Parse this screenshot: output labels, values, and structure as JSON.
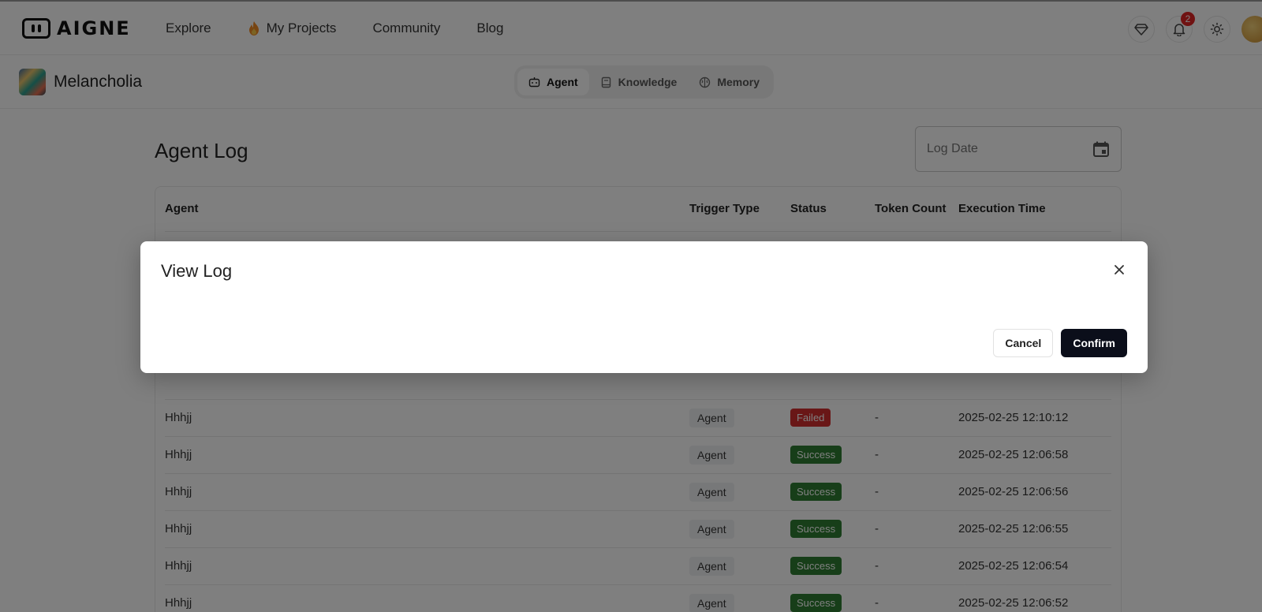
{
  "brand": {
    "name": "AIGNE"
  },
  "nav": {
    "items": [
      {
        "label": "Explore"
      },
      {
        "label": "My Projects"
      },
      {
        "label": "Community"
      },
      {
        "label": "Blog"
      }
    ]
  },
  "header_right": {
    "notification_count": "2"
  },
  "project": {
    "name": "Melancholia"
  },
  "tabs": [
    {
      "label": "Agent"
    },
    {
      "label": "Knowledge"
    },
    {
      "label": "Memory"
    }
  ],
  "page": {
    "title": "Agent Log",
    "date_placeholder": "Log Date"
  },
  "table": {
    "headers": {
      "agent": "Agent",
      "trigger_type": "Trigger Type",
      "status": "Status",
      "token_count": "Token Count",
      "execution_time": "Execution Time"
    },
    "rows": [
      {
        "agent": "Hhhjj",
        "trigger_type": "Agent",
        "status": "Failed",
        "token_count": "-",
        "execution_time": "2025-02-25 12:10:12"
      },
      {
        "agent": "Hhhjj",
        "trigger_type": "Agent",
        "status": "Success",
        "token_count": "-",
        "execution_time": "2025-02-25 12:06:58"
      },
      {
        "agent": "Hhhjj",
        "trigger_type": "Agent",
        "status": "Success",
        "token_count": "-",
        "execution_time": "2025-02-25 12:06:56"
      },
      {
        "agent": "Hhhjj",
        "trigger_type": "Agent",
        "status": "Success",
        "token_count": "-",
        "execution_time": "2025-02-25 12:06:55"
      },
      {
        "agent": "Hhhjj",
        "trigger_type": "Agent",
        "status": "Success",
        "token_count": "-",
        "execution_time": "2025-02-25 12:06:54"
      },
      {
        "agent": "Hhhjj",
        "trigger_type": "Agent",
        "status": "Success",
        "token_count": "-",
        "execution_time": "2025-02-25 12:06:52"
      }
    ]
  },
  "modal": {
    "title": "View Log",
    "cancel_label": "Cancel",
    "confirm_label": "Confirm"
  },
  "colors": {
    "success": "#2e7d32",
    "failed": "#d32f2f",
    "confirm_bg": "#0b0e1a",
    "badge": "#e02424"
  }
}
